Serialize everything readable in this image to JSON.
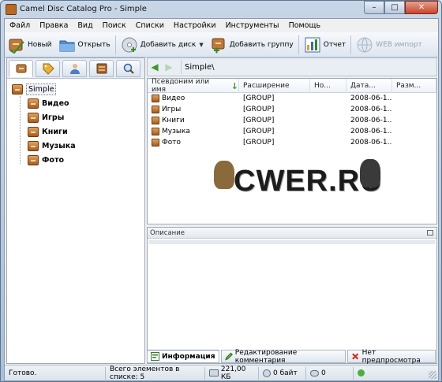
{
  "window": {
    "title": "Camel Disc Catalog Pro - Simple",
    "minimize": "–",
    "maximize": "□",
    "close": "✕"
  },
  "menu": [
    "Файл",
    "Правка",
    "Вид",
    "Поиск",
    "Списки",
    "Настройки",
    "Инструменты",
    "Помощь"
  ],
  "toolbar": {
    "new_label": "Новый",
    "open_label": "Открыть",
    "add_disc_label": "Добавить диск",
    "add_disc_arrow": "▼",
    "add_group_label": "Добавить группу",
    "report_label": "Отчет",
    "web_import_label": "WEB импорт"
  },
  "tree": {
    "root": "Simple",
    "children": [
      "Видео",
      "Игры",
      "Книги",
      "Музыка",
      "Фото"
    ]
  },
  "address": {
    "back": "◀",
    "forward": "▶",
    "path": "Simple\\"
  },
  "list": {
    "columns": [
      "Псевдоним или имя",
      "Расширение",
      "Но...",
      "Дата...",
      "Разм..."
    ],
    "sort_arrow": "↓",
    "rows": [
      {
        "name": "Видео",
        "ext": "[GROUP]",
        "no": "",
        "date": "2008-06-1...",
        "size": ""
      },
      {
        "name": "Игры",
        "ext": "[GROUP]",
        "no": "",
        "date": "2008-06-1...",
        "size": ""
      },
      {
        "name": "Книги",
        "ext": "[GROUP]",
        "no": "",
        "date": "2008-06-1...",
        "size": ""
      },
      {
        "name": "Музыка",
        "ext": "[GROUP]",
        "no": "",
        "date": "2008-06-1...",
        "size": ""
      },
      {
        "name": "Фото",
        "ext": "[GROUP]",
        "no": "",
        "date": "2008-06-1...",
        "size": ""
      }
    ]
  },
  "description": {
    "header": "Описание"
  },
  "bottom_tabs": [
    "Информация",
    "Редактирование комментария",
    "Нет предпросмотра"
  ],
  "watermark": "CWER.RU",
  "status": {
    "ready": "Готово.",
    "count": "Всего элементов в списке: 5",
    "size1": "221,00 КБ",
    "size2": "0 байт",
    "links": "0"
  },
  "colors": {
    "accent": "#3a9b28",
    "box": "#c07a35"
  }
}
